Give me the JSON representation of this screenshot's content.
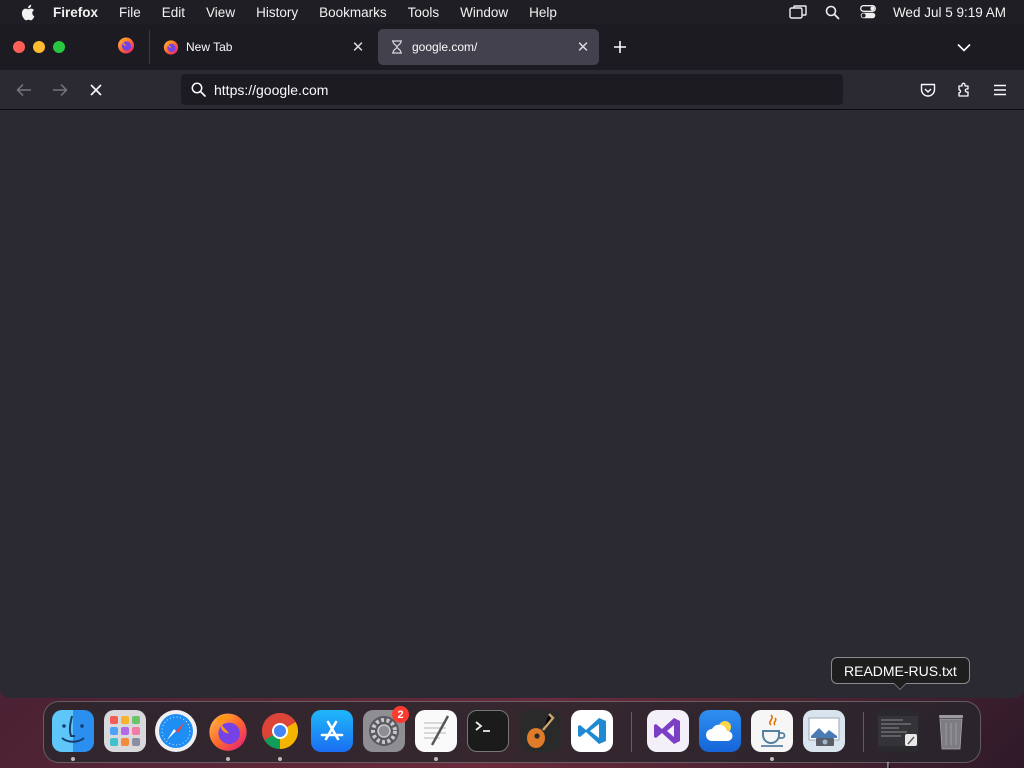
{
  "menubar": {
    "app_name": "Firefox",
    "items": [
      "File",
      "Edit",
      "View",
      "History",
      "Bookmarks",
      "Tools",
      "Window",
      "Help"
    ],
    "clock": "Wed Jul 5  9:19 AM"
  },
  "tabs": [
    {
      "title": "New Tab",
      "icon": "firefox-icon"
    },
    {
      "title": "google.com/",
      "icon": "hourglass-icon",
      "active": true
    }
  ],
  "urlbar": {
    "value": "https://google.com"
  },
  "tooltip": {
    "text": "README-RUS.txt"
  },
  "dock": {
    "apps": [
      "Finder",
      "Launchpad",
      "Safari",
      "Firefox",
      "Google Chrome",
      "App Store",
      "System Settings",
      "TextEdit",
      "Terminal",
      "GarageBand",
      "Visual Studio Code",
      "Visual Studio",
      "Weather",
      "Java",
      "Preview",
      "README-RUS.txt",
      "Trash"
    ],
    "settings_badge": "2"
  },
  "colors": {
    "window_bg": "#2b2a33",
    "tabstrip_bg": "#1c1b22",
    "active_tab_bg": "#42414d",
    "text": "#fbfbfe"
  }
}
